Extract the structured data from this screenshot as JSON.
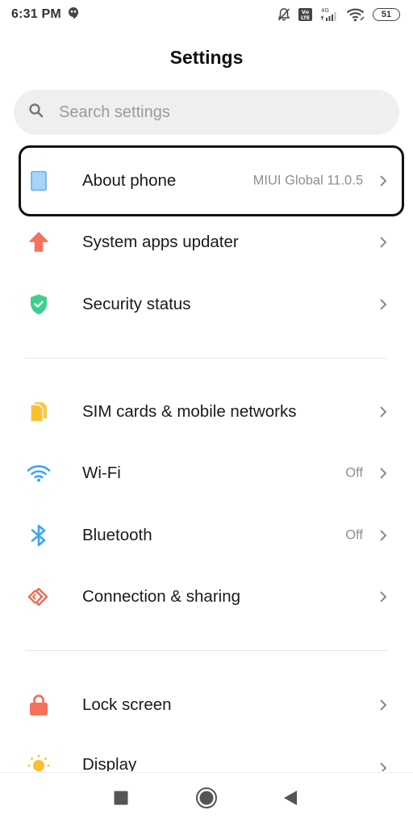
{
  "status_bar": {
    "time": "6:31 PM",
    "notification_icon": "hangouts-icon",
    "icons": [
      "bell-muted-icon",
      "volte-icon",
      "signal-4g-icon",
      "wifi-icon"
    ],
    "network_type": "4G",
    "volte_label": "Vo LTE",
    "battery_level": "51"
  },
  "header": {
    "title": "Settings"
  },
  "search": {
    "placeholder": "Search settings",
    "value": ""
  },
  "highlight": {
    "target": "about-phone",
    "color": "#111111"
  },
  "sections": [
    {
      "items": [
        {
          "id": "about-phone",
          "label": "About phone",
          "value": "MIUI Global 11.0.5",
          "icon": "phone-icon",
          "color": "#90caf9"
        },
        {
          "id": "system-apps-updater",
          "label": "System apps updater",
          "value": "",
          "icon": "arrow-up-icon",
          "color": "#f4725c"
        },
        {
          "id": "security-status",
          "label": "Security status",
          "value": "",
          "icon": "shield-check-icon",
          "color": "#3ecf8e"
        }
      ]
    },
    {
      "items": [
        {
          "id": "sim-cards",
          "label": "SIM cards & mobile networks",
          "value": "",
          "icon": "sim-card-icon",
          "color": "#fbc02d"
        },
        {
          "id": "wifi",
          "label": "Wi-Fi",
          "value": "Off",
          "icon": "wifi-icon",
          "color": "#3aa7ef"
        },
        {
          "id": "bluetooth",
          "label": "Bluetooth",
          "value": "Off",
          "icon": "bluetooth-icon",
          "color": "#3aa7ef"
        },
        {
          "id": "connection-sharing",
          "label": "Connection & sharing",
          "value": "",
          "icon": "connection-sharing-icon",
          "color": "#ee6a50"
        }
      ]
    },
    {
      "items": [
        {
          "id": "lock-screen",
          "label": "Lock screen",
          "value": "",
          "icon": "lock-icon",
          "color": "#f4725c"
        },
        {
          "id": "display",
          "label": "Display",
          "value": "",
          "icon": "sun-icon",
          "color": "#fbc02d"
        }
      ]
    }
  ],
  "nav_bar": {
    "buttons": [
      "recents-button",
      "home-button",
      "back-button"
    ]
  }
}
